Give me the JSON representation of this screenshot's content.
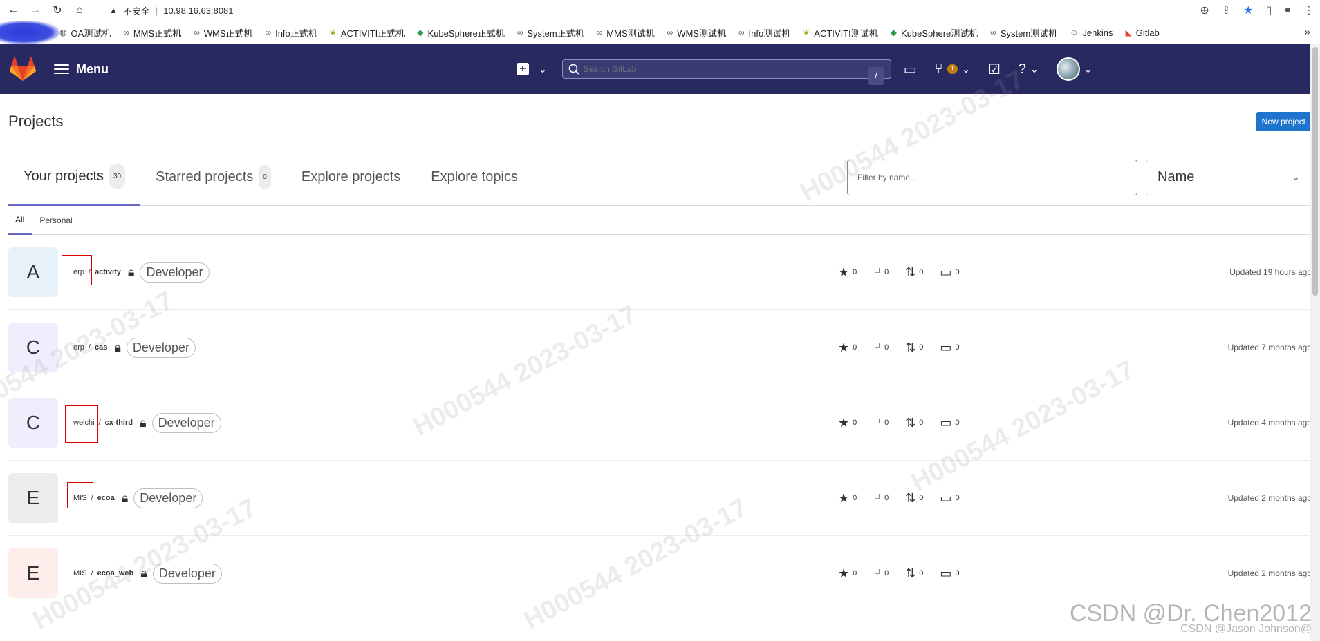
{
  "browser": {
    "security_label": "不安全",
    "url": "10.98.16.63:8081"
  },
  "bookmarks": [
    {
      "label": "OA测试机",
      "icon": "globe-icon"
    },
    {
      "label": "MMS正式机",
      "icon": "link-icon"
    },
    {
      "label": "WMS正式机",
      "icon": "link-icon"
    },
    {
      "label": "Info正式机",
      "icon": "link-icon"
    },
    {
      "label": "ACTIVITI正式机",
      "icon": "leaf-icon"
    },
    {
      "label": "KubeSphere正式机",
      "icon": "kubesphere-icon"
    },
    {
      "label": "System正式机",
      "icon": "link-icon"
    },
    {
      "label": "MMS测试机",
      "icon": "link-icon"
    },
    {
      "label": "WMS测试机",
      "icon": "link-icon"
    },
    {
      "label": "Info测试机",
      "icon": "link-icon"
    },
    {
      "label": "ACTIVITI测试机",
      "icon": "leaf-icon"
    },
    {
      "label": "KubeSphere测试机",
      "icon": "kubesphere-icon"
    },
    {
      "label": "System测试机",
      "icon": "link-icon"
    },
    {
      "label": "Jenkins",
      "icon": "jenkins-icon"
    },
    {
      "label": "Gitlab",
      "icon": "gitlab-icon"
    }
  ],
  "header": {
    "menu_label": "Menu",
    "search_placeholder": "Search GitLab",
    "search_shortcut": "/",
    "mr_badge": "1"
  },
  "page": {
    "title": "Projects",
    "new_project_label": "New project",
    "tabs": [
      {
        "label": "Your projects",
        "count": "30"
      },
      {
        "label": "Starred projects",
        "count": "0"
      },
      {
        "label": "Explore projects"
      },
      {
        "label": "Explore topics"
      }
    ],
    "filter_placeholder": "Filter by name...",
    "sort_label": "Name",
    "subtabs": [
      "All",
      "Personal"
    ]
  },
  "projects": [
    {
      "letter": "A",
      "namespace": "erp",
      "sep": " / ",
      "name": "activity",
      "role": "Developer",
      "stars": "0",
      "forks": "0",
      "mrs": "0",
      "issues": "0",
      "updated": "Updated 19 hours ago"
    },
    {
      "letter": "C",
      "namespace": "erp",
      "sep": " / ",
      "name": "cas",
      "role": "Developer",
      "stars": "0",
      "forks": "0",
      "mrs": "0",
      "issues": "0",
      "updated": "Updated 7 months ago"
    },
    {
      "letter": "C",
      "namespace": "weichi",
      "sep": " / ",
      "name": "cx-third",
      "role": "Developer",
      "stars": "0",
      "forks": "0",
      "mrs": "0",
      "issues": "0",
      "updated": "Updated 4 months ago"
    },
    {
      "letter": "E",
      "namespace": "MIS",
      "sep": " / ",
      "name": "ecoa",
      "role": "Developer",
      "stars": "0",
      "forks": "0",
      "mrs": "0",
      "issues": "0",
      "updated": "Updated 2 months ago"
    },
    {
      "letter": "E",
      "namespace": "MIS",
      "sep": " / ",
      "name": "ecoa_web",
      "role": "Developer",
      "stars": "0",
      "forks": "0",
      "mrs": "0",
      "issues": "0",
      "updated": "Updated 2 months ago"
    }
  ],
  "watermark": {
    "text": "H000544  2023-03-17",
    "csdn_main": "CSDN @Dr. Chen2012",
    "csdn_sub": "CSDN @Jason Johnson@"
  }
}
